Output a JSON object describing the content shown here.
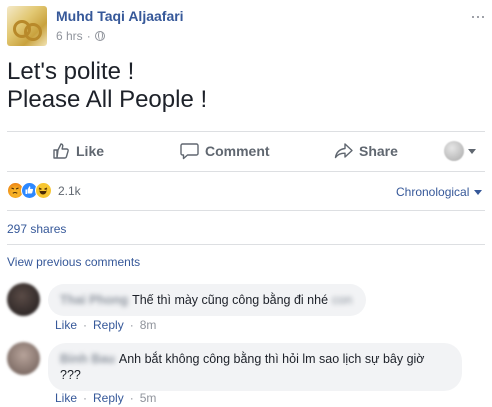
{
  "post": {
    "author": "Muhd Taqi Aljaafari",
    "time": "6 hrs",
    "more_icon": "more-icon",
    "lines": [
      "Let's polite !",
      "Please All People !"
    ]
  },
  "actions": {
    "like": "Like",
    "comment": "Comment",
    "share": "Share"
  },
  "reactions": {
    "icons": [
      "angry-emoji",
      "like-emoji",
      "haha-emoji"
    ],
    "count": "2.1k",
    "order": "Chronological"
  },
  "shares": "297 shares",
  "view_previous": "View previous comments",
  "comments": [
    {
      "name": "Thai Phong",
      "text": "Thế thì mày cũng công bằng đi nhé",
      "tail": "con",
      "like": "Like",
      "reply": "Reply",
      "time": "8m"
    },
    {
      "name": "Binh Bau",
      "text_line1": "Anh bắt không công bằng thì hỏi lm sao lịch sự bây giờ",
      "text_line2": "???",
      "like": "Like",
      "reply": "Reply",
      "time": "5m"
    }
  ],
  "colors": {
    "link": "#365899",
    "meta": "#90949c",
    "bubble": "#f2f3f5"
  }
}
